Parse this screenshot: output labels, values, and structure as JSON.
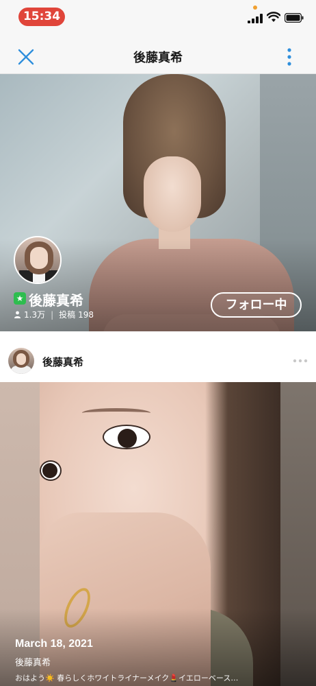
{
  "status_bar": {
    "time": "15:34",
    "icons": [
      "signal-icon",
      "wifi-icon",
      "battery-icon"
    ]
  },
  "nav": {
    "title": "後藤真希",
    "close_icon": "close-icon",
    "more_icon": "more-vertical-icon"
  },
  "profile": {
    "name": "後藤真希",
    "followers": "1.3万",
    "posts_label": "投稿",
    "posts_count": "198",
    "follow_button": "フォロー中",
    "verified_icon": "star-badge-icon"
  },
  "post": {
    "author": "後藤真希",
    "date": "March 18, 2021",
    "sub_author": "後藤真希",
    "caption": "おはよう☀️ 春らしくホワイトライナーメイク💄イエローベース…"
  },
  "colors": {
    "accent": "#2f8fdc",
    "time_pill": "#e0453a",
    "verified": "#2ebd4f"
  }
}
